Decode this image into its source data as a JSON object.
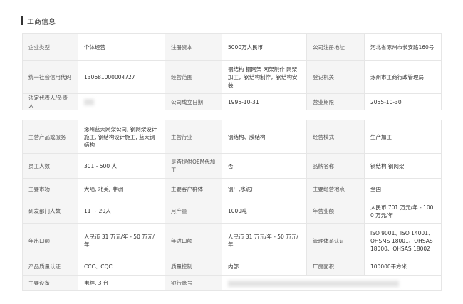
{
  "section": {
    "title": "工商信息"
  },
  "basic": [
    [
      "企业类型",
      "个体经营",
      "注册资本",
      "5000万人民币",
      "公司注册地址",
      "河北省涿州市长安路160号"
    ],
    [
      "统一社会信用代码",
      "130681000004727",
      "经营范围",
      "钢结构 钢网架 网架制作 网架加工，钢结构制作，钢结构安装",
      "登记机关",
      "涿州市工商行政管理局"
    ],
    [
      "法定代表人/负责人",
      "",
      "公司成立日期",
      "1995-10-31",
      "营业期限",
      "2055-10-30"
    ]
  ],
  "business": [
    [
      "主营产品或服务",
      "涿州蓝天网架公司, 钢网架设计施工, 钢结构设计施工, 蓝天钢结构",
      "主营行业",
      "钢结构、膜结构",
      "经营模式",
      "生产加工"
    ],
    [
      "员工人数",
      "301 - 500 人",
      "是否提供OEM代加工",
      "否",
      "品牌名称",
      "钢结构 钢网架"
    ],
    [
      "主要市场",
      "大陆, 北美, 非洲",
      "主要客户群体",
      "钢厂,水泥厂",
      "主要经营地点",
      "全国"
    ],
    [
      "研发部门人数",
      "11 ~ 20人",
      "月产量",
      "1000吨",
      "年营业额",
      "人民币 701 万元/年 - 1000 万元/年"
    ],
    [
      "年出口额",
      "人民币 31 万元/年 - 50 万元/年",
      "年进口额",
      "人民币 31 万元/年 - 50 万元/年",
      "管理体系认证",
      "ISO 9001、ISO 14001、OHSMS 18001、OHSAS 18000、OHSAS 18002"
    ],
    [
      "产品质量认证",
      "CCC、CQC",
      "质量控制",
      "内部",
      "厂房面积",
      "100000平方米"
    ],
    [
      "主要设备",
      "电焊, 3 台",
      "银行账号",
      "",
      "",
      ""
    ]
  ]
}
